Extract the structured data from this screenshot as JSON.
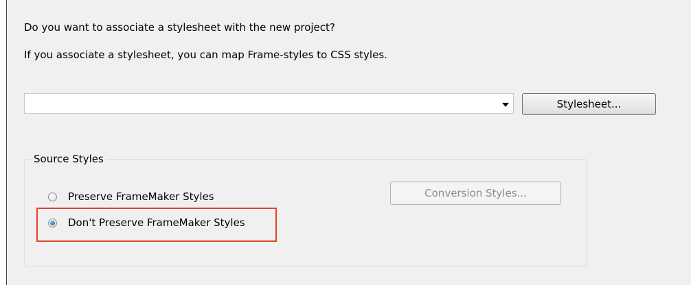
{
  "dialog": {
    "question": "Do you want to associate a stylesheet with the new project?",
    "info": "If you associate a stylesheet, you can map Frame-styles to CSS styles.",
    "stylesheet_combo": {
      "value": ""
    },
    "stylesheet_button_label": "Stylesheet...",
    "source_styles": {
      "legend": "Source Styles",
      "options": [
        {
          "label": "Preserve FrameMaker Styles",
          "selected": false
        },
        {
          "label": "Don't Preserve FrameMaker Styles",
          "selected": true
        }
      ],
      "conversion_button_label": "Conversion Styles...",
      "conversion_button_enabled": false
    }
  },
  "colors": {
    "highlight": "#e2432b",
    "background": "#f0f0f0"
  }
}
